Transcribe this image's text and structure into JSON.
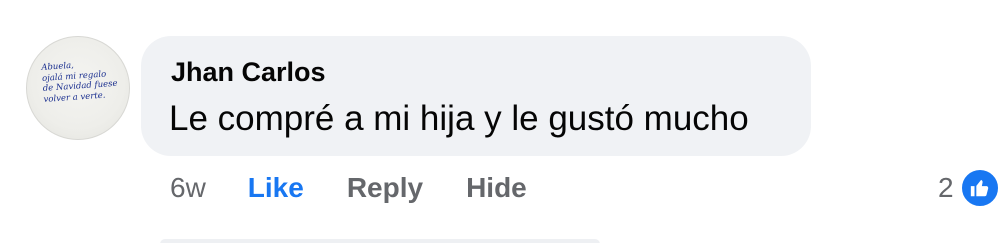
{
  "comment": {
    "author": "Jhan Carlos",
    "text": "Le compré a mi hija y le gustó mucho",
    "avatar_note": [
      "Abuela,",
      "ojalá mi regalo",
      "de Navidad fuese",
      "volver a verte."
    ],
    "time": "6w",
    "actions": {
      "like": "Like",
      "reply": "Reply",
      "hide": "Hide"
    },
    "reaction_count": "2",
    "reaction_icon": "thumbs-up-icon",
    "colors": {
      "bubble": "#f0f2f5",
      "like_active": "#1877f2",
      "muted": "#65676b"
    }
  }
}
